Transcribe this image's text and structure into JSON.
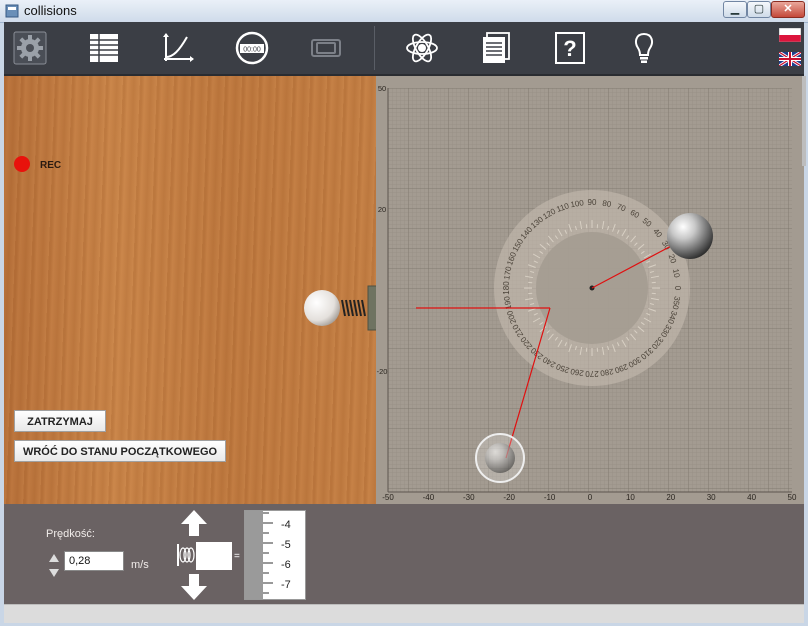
{
  "window": {
    "title": "collisions"
  },
  "toolbar": {
    "icons": [
      "settings-icon",
      "table-icon",
      "graph-icon",
      "stopwatch-icon",
      "camera-icon",
      "atom-icon",
      "document-icon",
      "help-icon",
      "lightbulb-icon"
    ],
    "stopwatch_text": "00:00",
    "help_text": "?",
    "languages": [
      "pl",
      "en"
    ]
  },
  "stage": {
    "rec_label": "REC",
    "stop_button": "ZATRZYMAJ",
    "reset_button": "WRÓĆ DO STANU POCZĄTKOWEGO"
  },
  "plot": {
    "x_ticks": [
      "-50",
      "-40",
      "-30",
      "-20",
      "-10",
      "0",
      "10",
      "20",
      "30",
      "40",
      "50"
    ],
    "y_ticks": [
      "50",
      "20",
      "-20"
    ],
    "protractor_labels": [
      "0",
      "10",
      "20",
      "30",
      "40",
      "50",
      "60",
      "70",
      "80",
      "90",
      "100",
      "110",
      "120",
      "130",
      "140",
      "150",
      "160",
      "170",
      "180",
      "190",
      "200",
      "210",
      "220",
      "230",
      "240",
      "250",
      "260",
      "270",
      "280",
      "290",
      "300",
      "310",
      "320",
      "330",
      "340",
      "350"
    ]
  },
  "controls": {
    "speed_label": "Prędkość:",
    "speed_value": "0,28",
    "speed_unit": "m/s",
    "equals": "=",
    "ruler_labels": [
      "-4",
      "-5",
      "-6",
      "-7"
    ]
  },
  "colors": {
    "accent_red": "#e8120c",
    "trajectory_red": "#e01010"
  }
}
